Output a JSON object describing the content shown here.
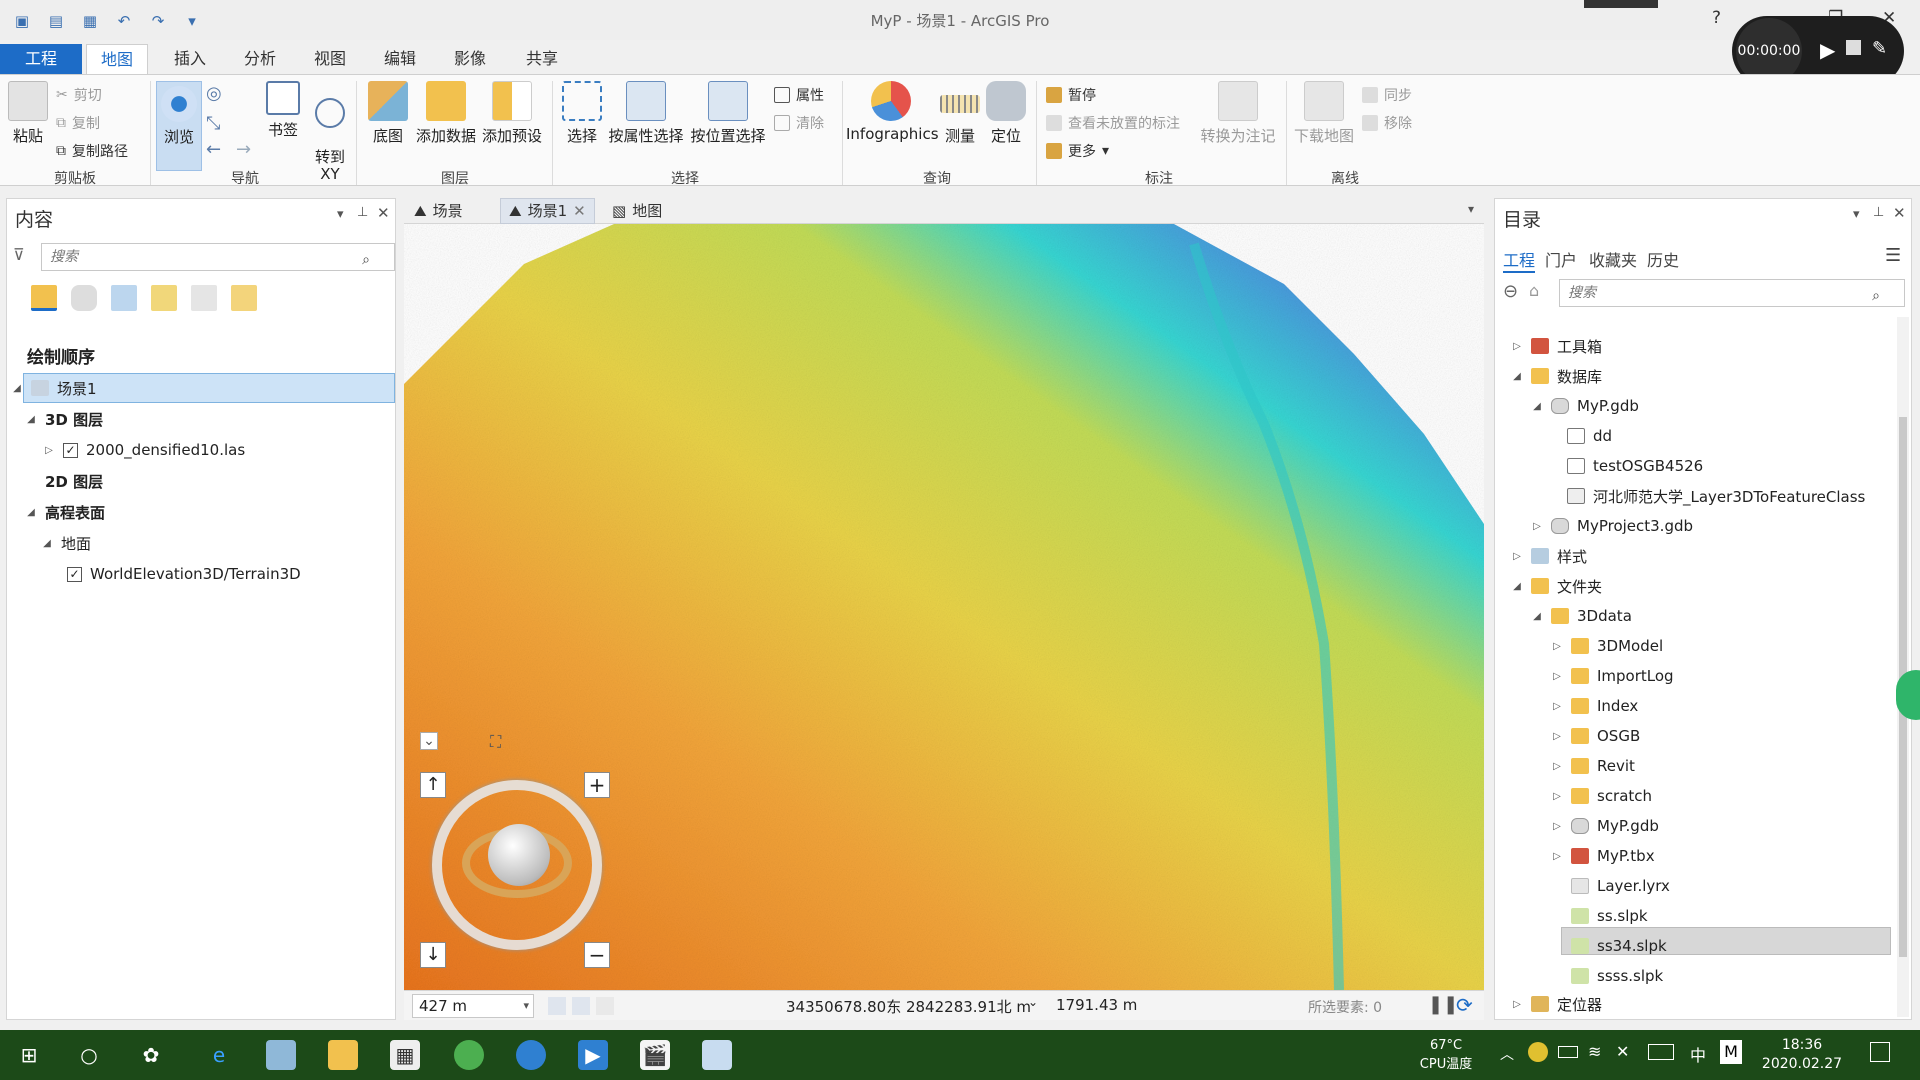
{
  "window": {
    "title": "MyP - 场景1 - ArcGIS Pro",
    "help": "?",
    "recorder_time": "00:00:00"
  },
  "ribbon_tabs": [
    "工程",
    "地图",
    "插入",
    "分析",
    "视图",
    "编辑",
    "影像",
    "共享"
  ],
  "ribbon": {
    "clipboard": {
      "paste": "粘贴",
      "cut": "剪切",
      "copy": "复制",
      "copy_path": "复制路径",
      "group": "剪贴板"
    },
    "navigate": {
      "explore": "浏览",
      "bookmarks": "书签",
      "goto_xy": "转到\nXY",
      "group": "导航"
    },
    "layer": {
      "basemap": "底图",
      "add_data": "添加数据",
      "add_preset": "添加预设",
      "group": "图层"
    },
    "selection": {
      "select": "选择",
      "by_attr": "按属性选择",
      "by_loc": "按位置选择",
      "attributes": "属性",
      "clear": "清除",
      "group": "选择"
    },
    "inquiry": {
      "infographics": "Infographics",
      "measure": "测量",
      "locate": "定位",
      "group": "查询"
    },
    "labeling": {
      "pause": "暂停",
      "view_unplaced": "查看未放置的标注",
      "more": "更多",
      "convert": "转换为注记",
      "group": "标注"
    },
    "offline": {
      "download": "下载地图",
      "sync": "同步",
      "remove": "移除",
      "group": "离线"
    }
  },
  "contents": {
    "title": "内容",
    "search_placeholder": "搜索",
    "drawing_order": "绘制顺序",
    "items": {
      "scene": "场景1",
      "layers3d": "3D 图层",
      "las": "2000_densified10.las",
      "layers2d": "2D 图层",
      "elev": "高程表面",
      "ground": "地面",
      "terrain": "WorldElevation3D/Terrain3D"
    }
  },
  "doc_tabs": [
    "场景",
    "场景1",
    "地图"
  ],
  "status": {
    "scale": "427 m",
    "coords": "34350678.80东 2842283.91北 m",
    "elevation": "1791.43 m",
    "selected": "所选要素: 0"
  },
  "catalog": {
    "title": "目录",
    "tabs": [
      "工程",
      "门户",
      "收藏夹",
      "历史"
    ],
    "search_placeholder": "搜索",
    "items": {
      "toolbox": "工具箱",
      "database": "数据库",
      "myp_gdb": "MyP.gdb",
      "dd": "dd",
      "osgb4526": "testOSGB4526",
      "hebei": "河北师范大学_Layer3DToFeatureClass",
      "myproject3": "MyProject3.gdb",
      "styles": "样式",
      "folders": "文件夹",
      "data3d": "3Ddata",
      "model3d": "3DModel",
      "importlog": "ImportLog",
      "index": "Index",
      "osgb": "OSGB",
      "revit": "Revit",
      "scratch": "scratch",
      "myp_gdb2": "MyP.gdb",
      "myp_tbx": "MyP.tbx",
      "layer_lyrx": "Layer.lyrx",
      "ss_slpk": "ss.slpk",
      "ss34_slpk": "ss34.slpk",
      "ssss_slpk": "ssss.slpk",
      "locators": "定位器"
    }
  },
  "taskbar": {
    "temp": "67°C",
    "temp_label": "CPU温度",
    "time": "18:36",
    "date": "2020.02.27",
    "ime": "中"
  },
  "colors": {
    "accent": "#1d6cc7",
    "taskbar": "#1c4a18",
    "selected_row": "#d7d7d7"
  }
}
